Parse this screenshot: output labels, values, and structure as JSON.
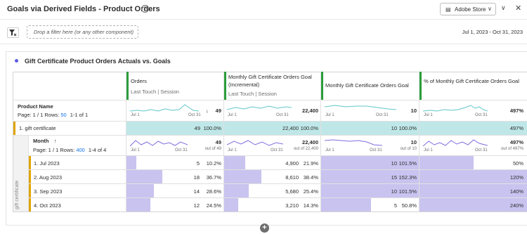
{
  "header": {
    "title": "Goals via Derived Fields - Product Orders",
    "info_glyph": "?",
    "report_suite": "Adobe Store",
    "chevron_glyph": "∨",
    "close_glyph": "✕"
  },
  "filterbar": {
    "dropzone_text": "Drop a filter here (or any other component)",
    "date_range": "Jul 1, 2023 - Oct 31, 2023"
  },
  "panel": {
    "title": "Gift Certificate Product Orders Actuals vs. Goals"
  },
  "table": {
    "dimension": {
      "label": "Product Name",
      "page_text": "Page: 1 / 1",
      "rows_label": "Rows:",
      "rows_value": "50",
      "range_text": "1-1 of 1"
    },
    "columns": [
      {
        "title": "Orders",
        "subtitle": "Last Touch | Session",
        "total": "49",
        "sort_glyph": "↓"
      },
      {
        "title": "Monthly Gift Certificate Orders Goal (Incremental)",
        "subtitle": "Last Touch | Session",
        "total": "22,400"
      },
      {
        "title": "Monthly Gift Certificate Orders Goal",
        "subtitle": "",
        "total": "10"
      },
      {
        "title": "% of Monthly Gift Certificate Orders Goal",
        "subtitle": "",
        "total": "497%"
      }
    ],
    "spark_start": "Jul 1",
    "spark_end": "Oct 31",
    "main_row": {
      "label": "1. gift certificate",
      "values": [
        "49",
        "100.0%",
        "22,400",
        "100.0%",
        "10",
        "100.0%",
        "497%"
      ]
    },
    "breakdown": {
      "label": "Month",
      "sort_glyph": "↑",
      "page_text": "Page: 1 / 1",
      "rows_label": "Rows:",
      "rows_value": "400",
      "range_text": "1-4 of 4",
      "totals": [
        {
          "value": "49",
          "sub": "out of 49"
        },
        {
          "value": "22,400",
          "sub": "out of 22,400"
        },
        {
          "value": "10",
          "sub": "out of 10"
        },
        {
          "value": "497%",
          "sub": "out of 497%"
        }
      ],
      "vertical_label": "gift certificate",
      "rows": [
        {
          "label": "1. Jul 2023",
          "c1": "5",
          "p1": "10.2%",
          "c2": "4,900",
          "p2": "21.9%",
          "c3": "10",
          "p3": "101.5%",
          "c4": "50%",
          "f1": 0.102,
          "f2": 0.219,
          "f3": 1.0,
          "f4": 0.5
        },
        {
          "label": "2. Aug 2023",
          "c1": "18",
          "p1": "36.7%",
          "c2": "8,610",
          "p2": "38.4%",
          "c3": "15",
          "p3": "152.3%",
          "c4": "120%",
          "f1": 0.367,
          "f2": 0.384,
          "f3": 1.0,
          "f4": 1.0
        },
        {
          "label": "3. Sep 2023",
          "c1": "14",
          "p1": "28.6%",
          "c2": "5,680",
          "p2": "25.4%",
          "c3": "10",
          "p3": "101.5%",
          "c4": "140%",
          "f1": 0.286,
          "f2": 0.254,
          "f3": 1.0,
          "f4": 1.0
        },
        {
          "label": "4. Oct 2023",
          "c1": "12",
          "p1": "24.5%",
          "c2": "3,210",
          "p2": "14.3%",
          "c3": "5",
          "p3": "50.8%",
          "c4": "240%",
          "f1": 0.245,
          "f2": 0.143,
          "f3": 0.508,
          "f4": 1.0
        }
      ]
    }
  },
  "add_glyph": "+",
  "colors": {
    "accent": "#2d9d3c",
    "teal": "#bfe7e8",
    "purple": "#c9c3f0",
    "link": "#1473e6",
    "panel_dot": "#5c5ce0"
  }
}
